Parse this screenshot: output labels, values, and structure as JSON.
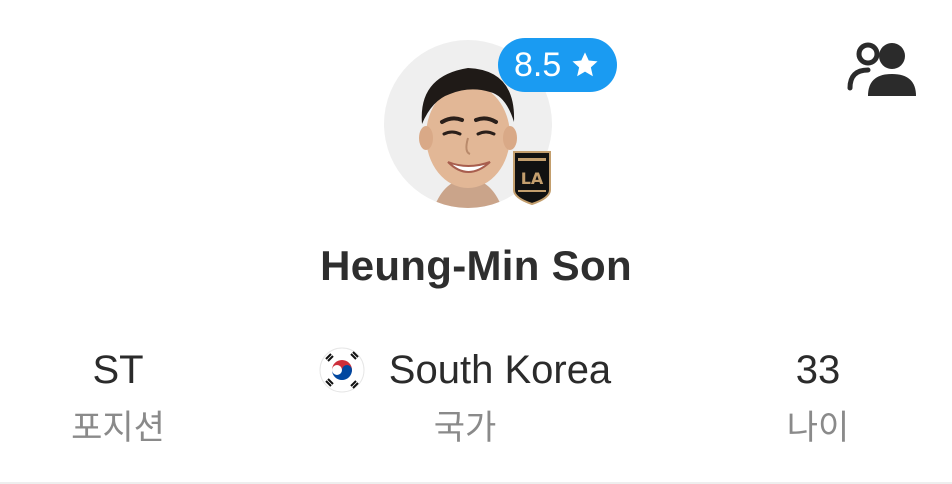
{
  "player": {
    "name": "Heung-Min Son",
    "rating": "8.5",
    "club_icon": "lafc-crest-icon",
    "compare_icon": "compare-players-icon"
  },
  "stats": [
    {
      "value": "ST",
      "label": "포지션"
    },
    {
      "value": "South Korea",
      "label": "국가",
      "flag_icon": "south-korea-flag-icon"
    },
    {
      "value": "33",
      "label": "나이"
    }
  ],
  "colors": {
    "rating_badge": "#1a9bf2",
    "text_primary": "#2e2e2e",
    "text_secondary": "#8a8a8a",
    "club_gold": "#c39e6d"
  }
}
